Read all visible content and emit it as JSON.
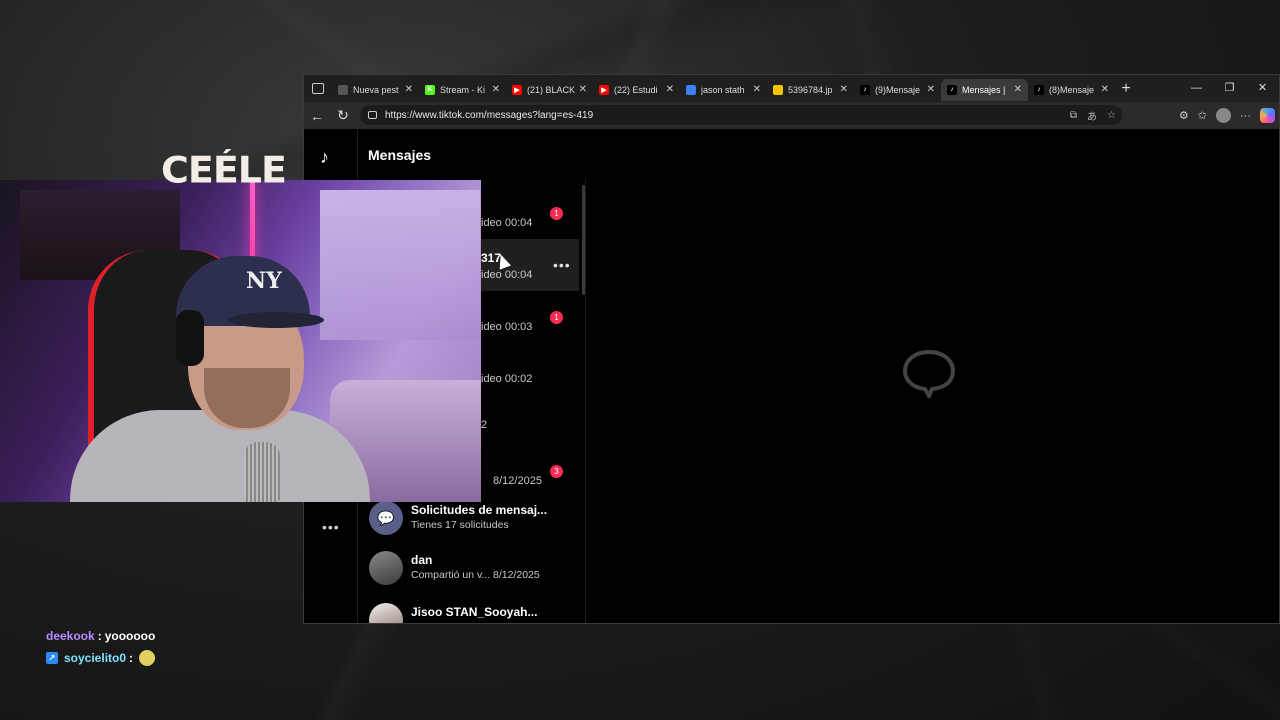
{
  "browser": {
    "tabs": [
      {
        "label": "Nueva pest",
        "favicon": "page-icon",
        "color": "#555555",
        "active": false
      },
      {
        "label": "Stream - Ki",
        "favicon": "kick-icon",
        "color": "#53fc18",
        "active": false
      },
      {
        "label": "(21) BLACK",
        "favicon": "youtube-icon",
        "color": "#ff0000",
        "active": false
      },
      {
        "label": "(22) Estudi",
        "favicon": "youtube-icon",
        "color": "#ff0000",
        "active": false
      },
      {
        "label": "jason stath",
        "favicon": "search-icon",
        "color": "#3b82f6",
        "active": false
      },
      {
        "label": "5396784.jp",
        "favicon": "image-icon",
        "color": "#f5c400",
        "active": false
      },
      {
        "label": "(9)Mensaje",
        "favicon": "tiktok-icon",
        "color": "#000000",
        "active": false
      },
      {
        "label": "Mensajes |",
        "favicon": "tiktok-icon",
        "color": "#000000",
        "active": true
      },
      {
        "label": "(8)Mensaje",
        "favicon": "tiktok-icon",
        "color": "#000000",
        "active": false
      }
    ],
    "new_tab": "+",
    "window_controls": {
      "minimize": "—",
      "maximize": "❐",
      "close": "✕"
    },
    "url": "https://www.tiktok.com/messages?lang=es-419"
  },
  "tiktok": {
    "title": "Mensajes",
    "rail_more": "•••",
    "conversations_partial": [
      {
        "name": "",
        "sub": "ideo 00:04",
        "badge": "1"
      },
      {
        "name": "317",
        "sub": "ideo 00:04",
        "badge": null,
        "hover": true
      },
      {
        "name": "",
        "sub": "ideo 00:03",
        "badge": "1"
      },
      {
        "name": "",
        "sub": "ideo 00:02",
        "badge": null
      },
      {
        "name": "",
        "sub": "2",
        "badge": null
      },
      {
        "name": "",
        "sub": "8/12/2025",
        "badge": "3"
      }
    ],
    "conversations": [
      {
        "name": "Solicitudes de mensaj...",
        "sub": "Tienes 17 solicitudes",
        "time": "",
        "avatar": "requests-icon"
      },
      {
        "name": "dan",
        "sub": "Compartió un v...",
        "time": "8/12/2025",
        "avatar": "avatar"
      },
      {
        "name": "Jisoo STAN_Sooyah...",
        "sub": "",
        "time": "",
        "avatar": "avatar"
      }
    ]
  },
  "overlay": {
    "logo": "CEÉLE",
    "chat": [
      {
        "user": "deekook",
        "sep": ":",
        "text": "yoooooo"
      },
      {
        "user": "soycielito0",
        "sep": ":",
        "text": ""
      }
    ]
  },
  "colors": {
    "tiktok_badge": "#fe2c55",
    "chat_user1": "#b98cff",
    "chat_user2": "#7fe0ff"
  }
}
